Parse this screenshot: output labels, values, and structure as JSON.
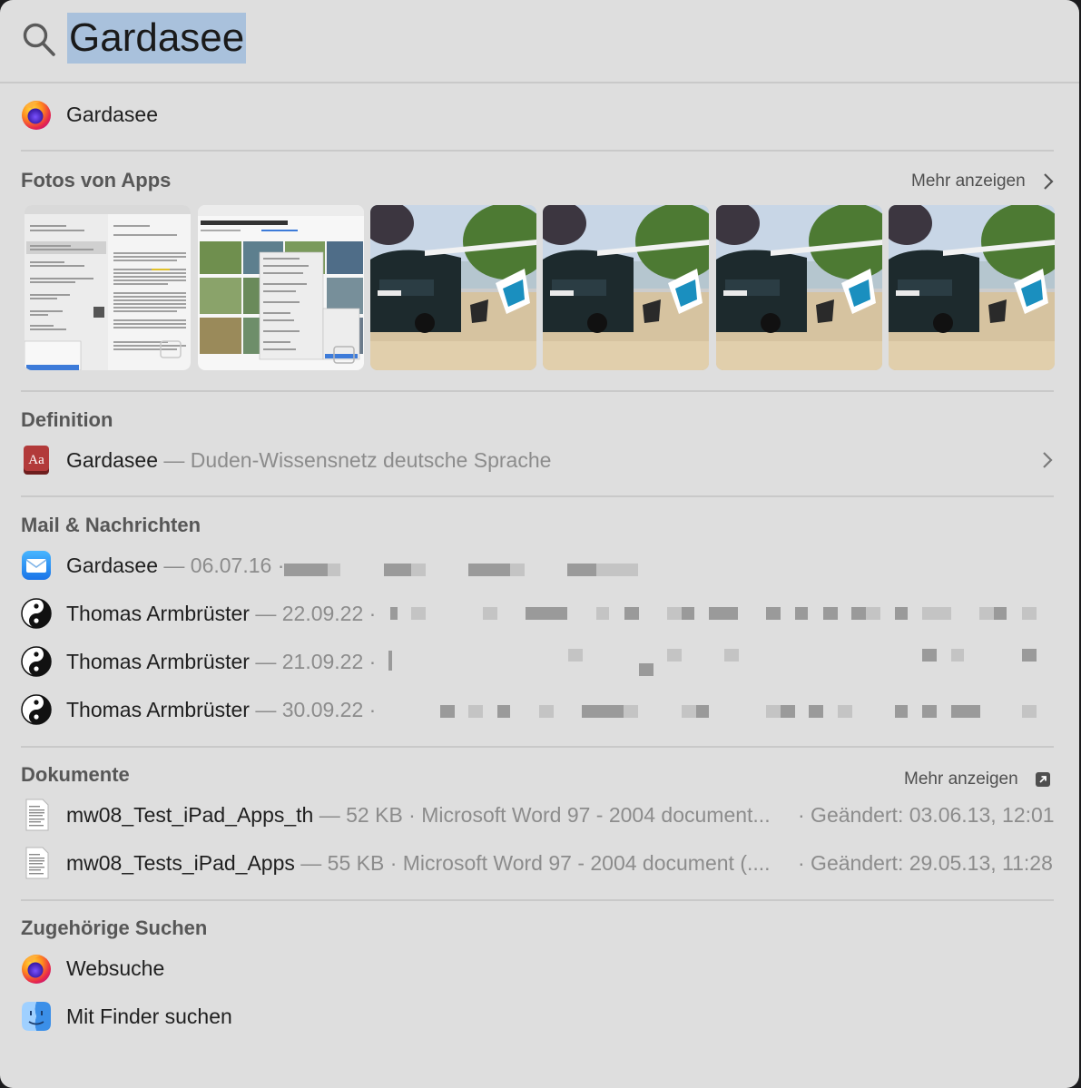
{
  "search": {
    "query": "Gardasee"
  },
  "top_hit": {
    "label": "Gardasee",
    "icon": "firefox-icon"
  },
  "photos": {
    "heading": "Fotos von Apps",
    "more_label": "Mehr anzeigen",
    "thumbnail_count": 6
  },
  "definition": {
    "heading": "Definition",
    "title": "Gardasee",
    "source": " — Duden-Wissensnetz deutsche Sprache",
    "icon": "dictionary-icon"
  },
  "mail": {
    "heading": "Mail & Nachrichten",
    "items": [
      {
        "title": "Gardasee",
        "date": " — 06.07.16 ·",
        "icon": "mail-icon"
      },
      {
        "title": "Thomas Armbrüster",
        "date": " — 22.09.22 ·",
        "icon": "yin-yang-icon"
      },
      {
        "title": "Thomas Armbrüster",
        "date": " — 21.09.22 ·",
        "icon": "yin-yang-icon"
      },
      {
        "title": "Thomas Armbrüster",
        "date": " — 30.09.22 ·",
        "icon": "yin-yang-icon"
      }
    ]
  },
  "documents": {
    "heading": "Dokumente",
    "more_label": "Mehr anzeigen",
    "items": [
      {
        "name": "mw08_Test_iPad_Apps_th",
        "meta": " — 52 KB · Microsoft Word 97 - 2004 document...",
        "modified": "· Geändert: 03.06.13, 12:01",
        "icon": "document-icon"
      },
      {
        "name": "mw08_Tests_iPad_Apps",
        "meta": " — 55 KB · Microsoft Word 97 - 2004 document (....",
        "modified": "· Geändert: 29.05.13, 11:28",
        "icon": "document-icon"
      }
    ]
  },
  "related": {
    "heading": "Zugehörige Suchen",
    "items": [
      {
        "label": "Websuche",
        "icon": "firefox-icon"
      },
      {
        "label": "Mit Finder suchen",
        "icon": "finder-icon"
      }
    ]
  }
}
